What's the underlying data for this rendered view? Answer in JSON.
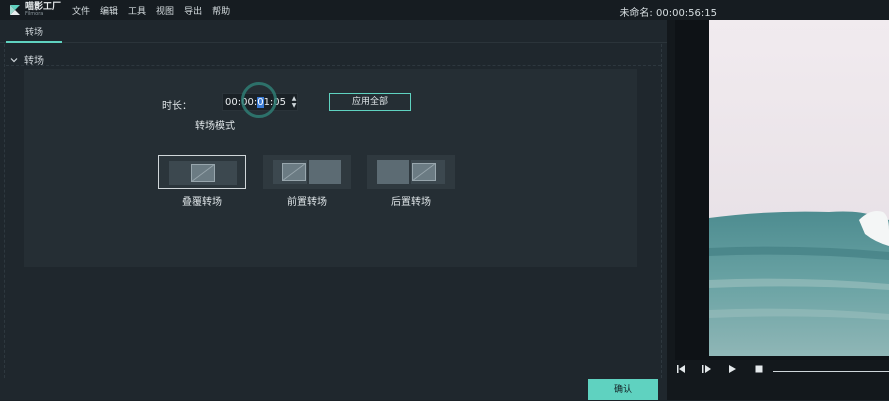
{
  "app": {
    "logo_text": "喵影工厂",
    "logo_sub": "Filmora",
    "window_title": "未命名: 00:00:56:15",
    "menu": [
      "文件",
      "编辑",
      "工具",
      "视图",
      "导出",
      "帮助"
    ]
  },
  "tab": {
    "label": "转场"
  },
  "section": {
    "title": "转场"
  },
  "duration": {
    "label": "时长：",
    "prefix": "00:00:",
    "selected": "0",
    "suffix": "1:05"
  },
  "apply_all_label": "应用全部",
  "mode_label": "转场模式",
  "modes": [
    {
      "label": "叠覆转场",
      "selected": true
    },
    {
      "label": "前置转场",
      "selected": false
    },
    {
      "label": "后置转场",
      "selected": false
    }
  ],
  "confirm_label": "确认",
  "colors": {
    "accent": "#5fd2c0",
    "sea": "#5f9a9b",
    "sky": "#ece5ea"
  },
  "player_icons": [
    "rewind-icon",
    "step-frame-icon",
    "play-icon",
    "stop-icon"
  ]
}
